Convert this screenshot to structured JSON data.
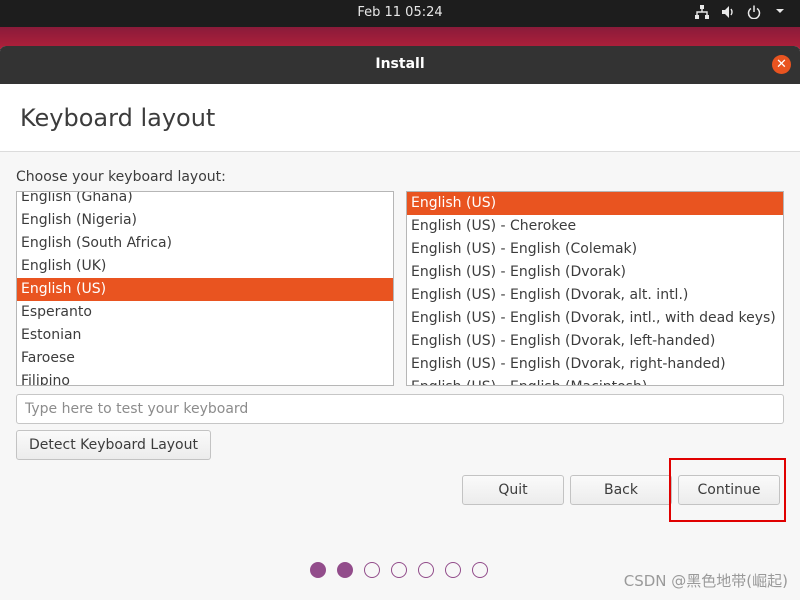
{
  "topbar": {
    "clock": "Feb 11  05:24",
    "icons": [
      "network-icon",
      "volume-icon",
      "power-icon",
      "chevron-down-icon"
    ]
  },
  "window": {
    "title": "Install",
    "close_icon": "close-icon",
    "accent_color": "#e95420"
  },
  "page": {
    "title": "Keyboard layout",
    "prompt": "Choose your keyboard layout:"
  },
  "layout_list": {
    "selected": "English (US)",
    "items": [
      "English (Ghana)",
      "English (Nigeria)",
      "English (South Africa)",
      "English (UK)",
      "English (US)",
      "Esperanto",
      "Estonian",
      "Faroese",
      "Filipino"
    ]
  },
  "variant_list": {
    "selected": "English (US)",
    "items": [
      "English (US)",
      "English (US) - Cherokee",
      "English (US) - English (Colemak)",
      "English (US) - English (Dvorak)",
      "English (US) - English (Dvorak, alt. intl.)",
      "English (US) - English (Dvorak, intl., with dead keys)",
      "English (US) - English (Dvorak, left-handed)",
      "English (US) - English (Dvorak, right-handed)",
      "English (US) - English (Macintosh)"
    ]
  },
  "test_field": {
    "placeholder": "Type here to test your keyboard",
    "value": ""
  },
  "buttons": {
    "detect": "Detect Keyboard Layout",
    "quit": "Quit",
    "back": "Back",
    "continue": "Continue"
  },
  "progress": {
    "total_steps": 7,
    "completed_steps": 2,
    "color": "#924d8b"
  },
  "watermark": "CSDN @黑色地带(崛起)"
}
